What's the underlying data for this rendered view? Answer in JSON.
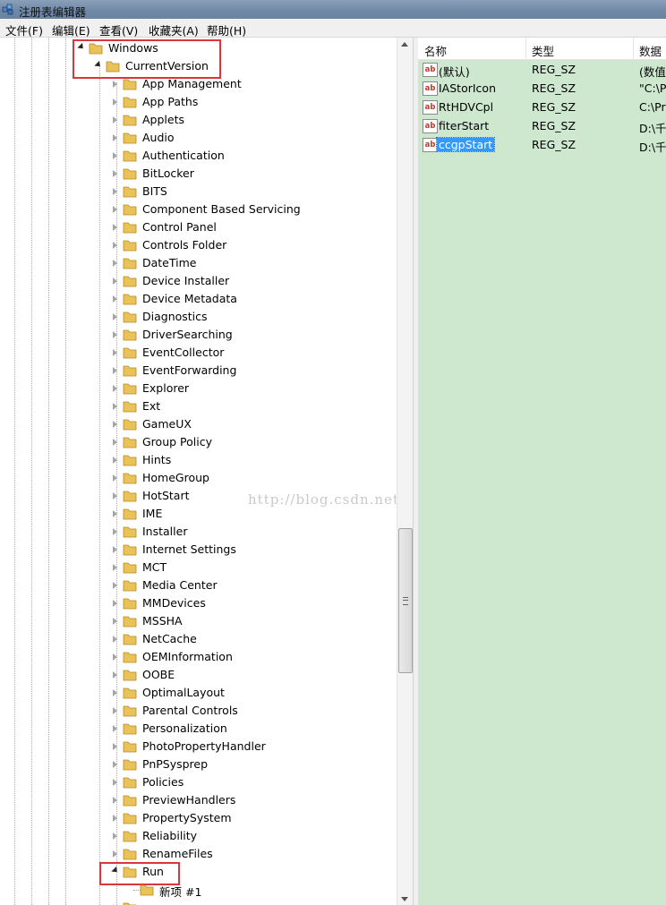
{
  "window": {
    "title": "注册表编辑器"
  },
  "menu": [
    {
      "label": "文件(F)"
    },
    {
      "label": "编辑(E)"
    },
    {
      "label": "查看(V)"
    },
    {
      "label": "收藏夹(A)"
    },
    {
      "label": "帮助(H)"
    }
  ],
  "tree": {
    "windows": "Windows",
    "current_version": "CurrentVersion",
    "children": [
      "App Management",
      "App Paths",
      "Applets",
      "Audio",
      "Authentication",
      "BitLocker",
      "BITS",
      "Component Based Servicing",
      "Control Panel",
      "Controls Folder",
      "DateTime",
      "Device Installer",
      "Device Metadata",
      "Diagnostics",
      "DriverSearching",
      "EventCollector",
      "EventForwarding",
      "Explorer",
      "Ext",
      "GameUX",
      "Group Policy",
      "Hints",
      "HomeGroup",
      "HotStart",
      "IME",
      "Installer",
      "Internet Settings",
      "MCT",
      "Media Center",
      "MMDevices",
      "MSSHA",
      "NetCache",
      "OEMInformation",
      "OOBE",
      "OptimalLayout",
      "Parental Controls",
      "Personalization",
      "PhotoPropertyHandler",
      "PnPSysprep",
      "Policies",
      "PreviewHandlers",
      "PropertySystem",
      "Reliability",
      "RenameFiles"
    ],
    "run": "Run",
    "run_child": "新项 #1"
  },
  "watermark": "http://blog.csdn.net/",
  "list": {
    "columns": {
      "name": "名称",
      "type": "类型",
      "data": "数据"
    },
    "rows": [
      {
        "name": "(默认)",
        "type": "REG_SZ",
        "data": "(数值未"
      },
      {
        "name": "IAStorIcon",
        "type": "REG_SZ",
        "data": "\"C:\\Pr"
      },
      {
        "name": "RtHDVCpl",
        "type": "REG_SZ",
        "data": "C:\\Pro"
      },
      {
        "name": "fiterStart",
        "type": "REG_SZ",
        "data": "D:\\千人"
      },
      {
        "name": "ccgpStart",
        "type": "REG_SZ",
        "data": "D:\\千人",
        "selected": true
      }
    ],
    "value_icon_text": "ab"
  },
  "colors": {
    "list_bg": "#cde8cf",
    "highlight_box": "#d9373d",
    "selection": "#3399ff",
    "folder": "#e9c35a"
  }
}
